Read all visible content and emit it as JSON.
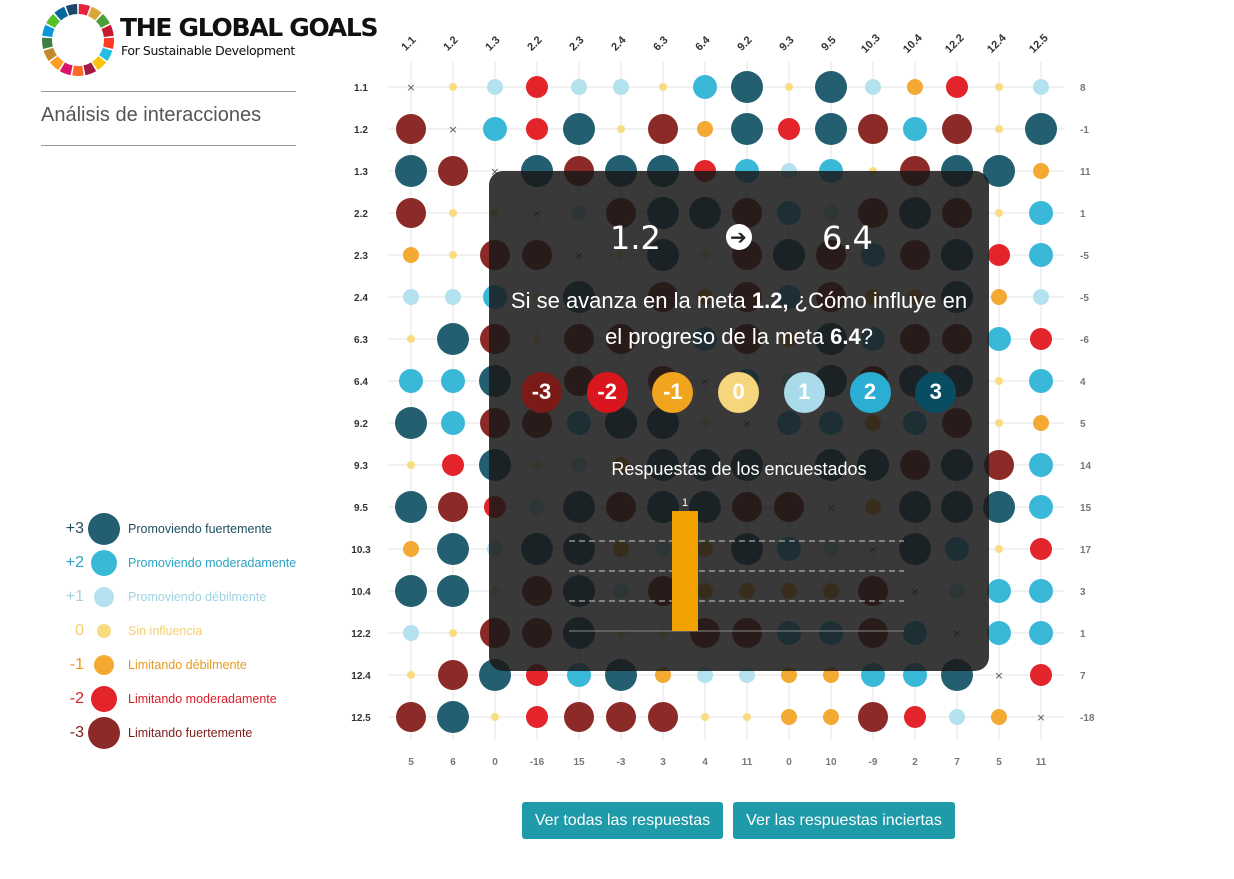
{
  "logo": {
    "title": "THE GLOBAL GOALS",
    "subtitle": "For Sustainable Development",
    "colors": [
      "#e5243b",
      "#dda63a",
      "#4c9f38",
      "#c5192d",
      "#ff3a21",
      "#26bde2",
      "#fcc30b",
      "#a21942",
      "#fd6925",
      "#dd1367",
      "#fd9d24",
      "#bf8b2e",
      "#3f7e44",
      "#0a97d9",
      "#56c02b",
      "#00689d",
      "#19486a"
    ]
  },
  "sidebar": {
    "title": "Análisis de interacciones"
  },
  "legend": [
    {
      "score": "+3",
      "label": "Promoviendo fuertemente",
      "color": "#235f70",
      "text_color": "#1f4e5f"
    },
    {
      "score": "+2",
      "label": "Promoviendo moderadamente",
      "color": "#3ab8d8",
      "text_color": "#2aa3c4"
    },
    {
      "score": "+1",
      "label": "Promoviendo débilmente",
      "color": "#b3e1ee",
      "text_color": "#9fd3e3"
    },
    {
      "score": "0",
      "label": "Sin influencia",
      "color": "#f7dc82",
      "text_color": "#f2cf6a"
    },
    {
      "score": "-1",
      "label": "Limitando débilmente",
      "color": "#f3a932",
      "text_color": "#e69a1c"
    },
    {
      "score": "-2",
      "label": "Limitando moderadamente",
      "color": "#e3242b",
      "text_color": "#d71f26"
    },
    {
      "score": "-3",
      "label": "Limitando fuertemente",
      "color": "#8b2a26",
      "text_color": "#7d1d1a"
    }
  ],
  "chart_data": {
    "type": "matrix",
    "columns": [
      "1.1",
      "1.2",
      "1.3",
      "2.2",
      "2.3",
      "2.4",
      "6.3",
      "6.4",
      "9.2",
      "9.3",
      "9.5",
      "10.3",
      "10.4",
      "12.2",
      "12.4",
      "12.5"
    ],
    "rows": [
      "1.1",
      "1.2",
      "1.3",
      "2.2",
      "2.3",
      "2.4",
      "6.3",
      "6.4",
      "9.2",
      "9.3",
      "9.5",
      "10.3",
      "10.4",
      "12.2",
      "12.4",
      "12.5"
    ],
    "values": [
      [
        null,
        0,
        1,
        -2,
        1,
        1,
        0,
        2,
        3,
        0,
        3,
        1,
        -1,
        -2,
        0,
        1
      ],
      [
        -3,
        null,
        2,
        -2,
        3,
        0,
        -3,
        -1,
        3,
        -2,
        3,
        -3,
        2,
        -3,
        0,
        3
      ],
      [
        3,
        -3,
        null,
        3,
        -3,
        3,
        3,
        -2,
        2,
        1,
        2,
        0,
        -3,
        3,
        3,
        -1
      ],
      [
        -3,
        0,
        0,
        null,
        1,
        -3,
        3,
        3,
        -3,
        2,
        1,
        -3,
        3,
        -3,
        0,
        2
      ],
      [
        -1,
        0,
        -3,
        -3,
        null,
        0,
        3,
        0,
        -3,
        3,
        -3,
        2,
        -3,
        3,
        -2,
        2
      ],
      [
        1,
        1,
        2,
        0,
        3,
        null,
        -3,
        -1,
        -3,
        2,
        -3,
        -1,
        -1,
        3,
        -1,
        1
      ],
      [
        0,
        3,
        -3,
        0,
        -3,
        -3,
        null,
        2,
        -3,
        -1,
        3,
        2,
        -3,
        -3,
        2,
        -2
      ],
      [
        2,
        2,
        3,
        0,
        -3,
        0,
        -3,
        null,
        2,
        1,
        3,
        -3,
        3,
        3,
        0,
        2
      ],
      [
        3,
        2,
        -3,
        -3,
        2,
        3,
        3,
        0,
        null,
        2,
        2,
        -1,
        2,
        -3,
        0,
        -1
      ],
      [
        0,
        -2,
        3,
        0,
        1,
        -1,
        3,
        3,
        3,
        null,
        3,
        3,
        -3,
        3,
        -3,
        2
      ],
      [
        3,
        -3,
        -2,
        1,
        3,
        -3,
        3,
        3,
        -3,
        -3,
        null,
        -1,
        3,
        3,
        3,
        2
      ],
      [
        -1,
        3,
        1,
        3,
        3,
        -1,
        1,
        -1,
        3,
        2,
        1,
        null,
        3,
        2,
        0,
        -2
      ],
      [
        3,
        3,
        0,
        -3,
        3,
        1,
        -3,
        -1,
        -1,
        -1,
        -1,
        -3,
        null,
        1,
        2,
        2
      ],
      [
        1,
        0,
        -3,
        -3,
        3,
        0,
        0,
        -3,
        -3,
        2,
        2,
        -3,
        2,
        null,
        2,
        2
      ],
      [
        0,
        -3,
        3,
        -2,
        2,
        3,
        -1,
        1,
        1,
        -1,
        -1,
        2,
        2,
        3,
        null,
        -2
      ],
      [
        -3,
        3,
        0,
        -2,
        -3,
        -3,
        -3,
        0,
        0,
        -1,
        -1,
        -3,
        -2,
        1,
        -1,
        null
      ]
    ],
    "row_totals": [
      "8",
      "-1",
      "11",
      "1",
      "-5",
      "-5",
      "-6",
      "4",
      "5",
      "14",
      "15",
      "17",
      "3",
      "1",
      "7",
      "-18"
    ],
    "column_totals": [
      "5",
      "6",
      "0",
      "-16",
      "15",
      "-3",
      "3",
      "4",
      "11",
      "0",
      "10",
      "-9",
      "2",
      "7",
      "5",
      "11"
    ]
  },
  "buttons": {
    "all_responses": "Ver todas las respuestas",
    "uncertain_responses": "Ver las respuestas inciertas"
  },
  "overlay": {
    "from_goal": "1.2",
    "to_goal": "6.4",
    "arrow_icon": "arrow-right-icon",
    "question_part1": "Si se avanza en la meta ",
    "question_goal1": "1.2,",
    "question_part2": " ¿Cómo influye en el progreso de la meta ",
    "question_goal2": "6.4",
    "question_part3": "?",
    "scale": [
      {
        "label": "-3",
        "color": "#7b1b17"
      },
      {
        "label": "-2",
        "color": "#d9161d"
      },
      {
        "label": "-1",
        "color": "#f1a51e"
      },
      {
        "label": "0",
        "color": "#f6d67c"
      },
      {
        "label": "1",
        "color": "#a9dbea"
      },
      {
        "label": "2",
        "color": "#2aaed4"
      },
      {
        "label": "3",
        "color": "#084d62"
      }
    ],
    "responses_title": "Respuestas de los encuestados",
    "responses_chart": {
      "type": "bar",
      "categories": [
        "-3",
        "-2",
        "-1",
        "0",
        "1",
        "2",
        "3"
      ],
      "values": [
        0,
        0,
        1,
        0,
        0,
        0,
        0
      ],
      "bar_label": "1",
      "bar_color": "#f1a100"
    }
  }
}
